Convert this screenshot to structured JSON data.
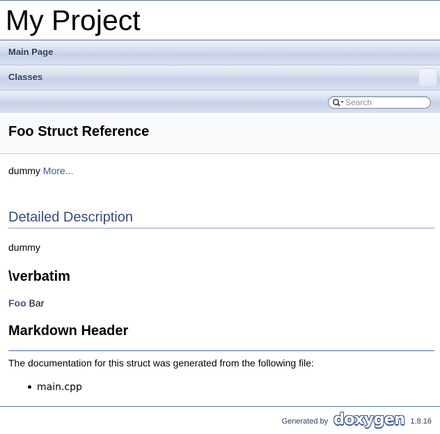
{
  "project": {
    "name": "My Project"
  },
  "nav": {
    "main_page": "Main Page",
    "classes": "Classes"
  },
  "search": {
    "placeholder": "Search"
  },
  "header": {
    "title": "Foo Struct Reference"
  },
  "brief": {
    "text": "dummy",
    "more_link": "More..."
  },
  "detailed": {
    "heading": "Detailed Description",
    "text": "dummy",
    "verbatim_heading": "\\verbatim",
    "foo_link": "Foo",
    "foo_rest": " Bar",
    "markdown_heading": "Markdown Header"
  },
  "files": {
    "intro": "The documentation for this struct was generated from the following file:",
    "items": [
      "main.cpp"
    ]
  },
  "footer": {
    "generated_by": "Generated by",
    "logo": "doxygen",
    "version": "1.8.16"
  },
  "colors": {
    "link": "#3d578c",
    "groupheader": "#354c7b",
    "nav_text": "#283a5d"
  }
}
